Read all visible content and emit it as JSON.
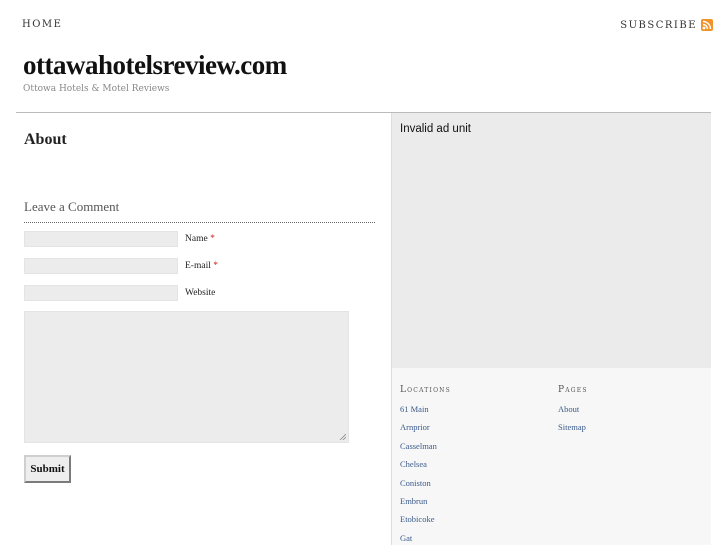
{
  "topnav": {
    "home_label": "HOME",
    "subscribe_label": "SUBSCRIBE",
    "rss_icon": "rss-icon",
    "rss_color": "#f0932b"
  },
  "site": {
    "title": "ottawahotelsreview.com",
    "tagline": "Ottowa Hotels & Motel Reviews"
  },
  "main": {
    "page_title": "About",
    "comment_heading": "Leave a Comment",
    "fields": {
      "name_label": "Name",
      "email_label": "E-mail",
      "website_label": "Website",
      "required_mark": "*"
    },
    "submit_label": "Submit"
  },
  "ad": {
    "text": "Invalid ad unit"
  },
  "sidebar": {
    "locations": {
      "title": "Locations",
      "items": [
        "61 Main",
        "Arnprior",
        "Casselman",
        "Chelsea",
        "Coniston",
        "Embrun",
        "Etobicoke",
        "Gat"
      ]
    },
    "pages": {
      "title": "Pages",
      "items": [
        "About",
        "Sitemap"
      ]
    }
  }
}
